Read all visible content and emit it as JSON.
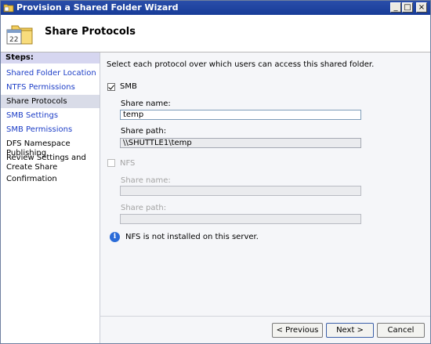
{
  "window": {
    "title": "Provision a Shared Folder Wizard",
    "minimize_glyph": "_",
    "maximize_glyph": "□",
    "close_glyph": "×"
  },
  "header": {
    "title": "Share Protocols",
    "icon": "folder-calendar-icon"
  },
  "sidebar": {
    "label": "Steps:",
    "items": [
      {
        "label": "Shared Folder Location",
        "state": "link"
      },
      {
        "label": "NTFS Permissions",
        "state": "link"
      },
      {
        "label": "Share Protocols",
        "state": "current"
      },
      {
        "label": "SMB Settings",
        "state": "link"
      },
      {
        "label": "SMB Permissions",
        "state": "link"
      },
      {
        "label": "DFS Namespace Publishing",
        "state": "plain"
      },
      {
        "label": "Review Settings and Create Share",
        "state": "plain"
      },
      {
        "label": "Confirmation",
        "state": "plain"
      }
    ]
  },
  "main": {
    "instruction": "Select each protocol over which users can access this shared folder.",
    "smb": {
      "label": "SMB",
      "checked": true,
      "share_name_label": "Share name:",
      "share_name_value": "temp",
      "share_path_label": "Share path:",
      "share_path_value": "\\\\SHUTTLE1\\temp"
    },
    "nfs": {
      "label": "NFS",
      "checked": false,
      "share_name_label": "Share name:",
      "share_name_value": "",
      "share_path_label": "Share path:",
      "share_path_value": ""
    },
    "info_message": "NFS is not installed on this server."
  },
  "footer": {
    "previous_label": "< Previous",
    "next_label": "Next >",
    "cancel_label": "Cancel"
  },
  "colors": {
    "titlebar": "#173c98",
    "link": "#1d3ec7",
    "steps_header": "#d6d6f0",
    "current_step": "#d9dce8",
    "content_bg": "#f5f6f9"
  }
}
